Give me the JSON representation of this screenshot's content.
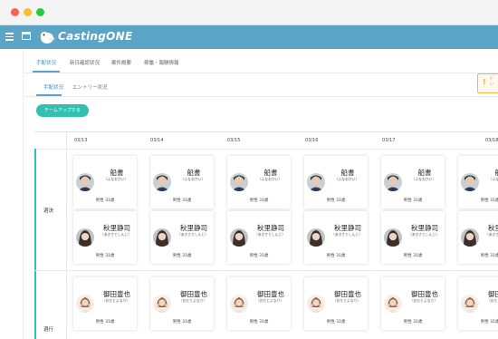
{
  "app": {
    "title": "CastingONE"
  },
  "icons": {
    "menu": "hamburger-menu-icon",
    "window": "window-icon",
    "logo": "bird-logo-icon",
    "alert": "exclamation-icon"
  },
  "colors": {
    "header": "#5ba4c5",
    "accent": "#33c0b1",
    "warning": "#f2a02b"
  },
  "main_tabs": [
    "手配状況",
    "新日確認状況",
    "案件概要",
    "稼働・報酬情報"
  ],
  "sub_tabs": [
    "手配状況",
    "エントリー状況"
  ],
  "alert": {
    "text": "ﾀﾞ\nい"
  },
  "team_button": "チームアップする",
  "dates": [
    "03/13",
    "03/14",
    "03/15",
    "03/16",
    "03/17",
    "03/18"
  ],
  "rows": [
    {
      "label": "週決",
      "people": [
        {
          "name": "船書",
          "kana": "（ふなおかい）",
          "info": "男性 31歳"
        },
        {
          "name": "秋里静司",
          "kana": "（あきさとしんじ）",
          "info": "男性 31歳"
        }
      ]
    },
    {
      "label": "週行",
      "people": [
        {
          "name": "御田豊也",
          "kana": "（おだとよなり）",
          "info": "男性 31歳"
        }
      ]
    }
  ]
}
